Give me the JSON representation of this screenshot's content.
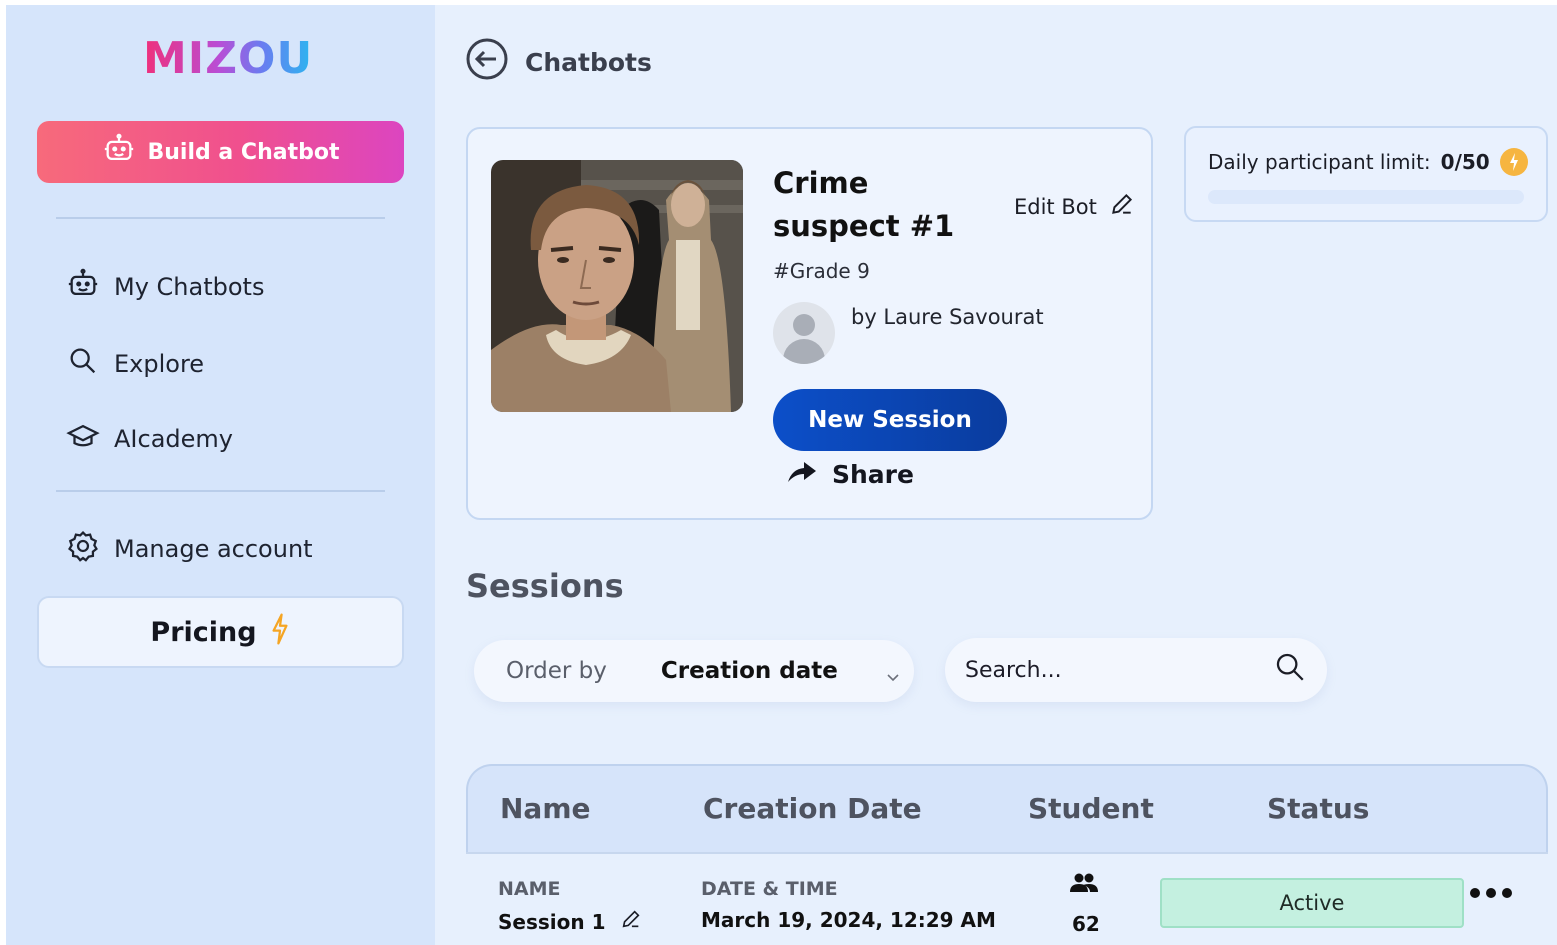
{
  "brand": {
    "logo_text": "MIZOU",
    "accent_gradient": [
      "#f76a7b",
      "#dc45c0"
    ]
  },
  "sidebar": {
    "build_label": "Build a Chatbot",
    "items": [
      {
        "label": "My Chatbots",
        "icon": "bot-icon"
      },
      {
        "label": "Explore",
        "icon": "search-icon"
      },
      {
        "label": "AIcademy",
        "icon": "graduation-cap-icon"
      }
    ],
    "manage_label": "Manage account",
    "pricing_label": "Pricing"
  },
  "header": {
    "back_title": "Chatbots"
  },
  "bot": {
    "title": "Crime suspect #1",
    "edit_label": "Edit Bot",
    "grade": "#Grade 9",
    "author": "by Laure Savourat",
    "new_session_label": "New Session",
    "share_label": "Share"
  },
  "limit": {
    "label": "Daily participant limit:",
    "value": "0/50",
    "fraction": 0
  },
  "sessions": {
    "heading": "Sessions",
    "order_label": "Order by",
    "order_value": "Creation date",
    "search_placeholder": "Search...",
    "columns": [
      "Name",
      "Creation Date",
      "Student",
      "Status"
    ],
    "rows": [
      {
        "name_label": "NAME",
        "name": "Session 1",
        "date_label": "DATE & TIME",
        "date": "March 19, 2024, 12:29 AM",
        "students": "62",
        "status": "Active"
      }
    ]
  }
}
